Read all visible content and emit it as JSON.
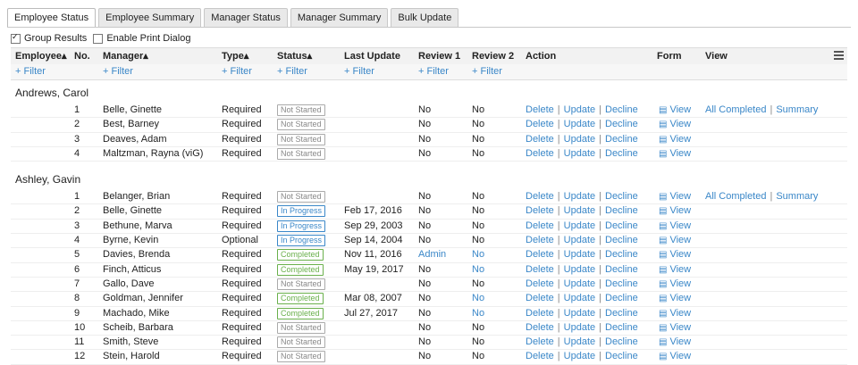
{
  "tabs": [
    "Employee Status",
    "Employee Summary",
    "Manager Status",
    "Manager Summary",
    "Bulk Update"
  ],
  "options": {
    "group_results": "Group Results",
    "print_dialog": "Enable Print Dialog"
  },
  "columns": {
    "employee": "Employee▴",
    "no": "No.",
    "manager": "Manager▴",
    "type": "Type▴",
    "status": "Status▴",
    "last_update": "Last Update",
    "review1": "Review 1",
    "review2": "Review 2",
    "action": "Action",
    "form": "Form",
    "view": "View"
  },
  "filter_label": "+ Filter",
  "actions": {
    "delete": "Delete",
    "update": "Update",
    "decline": "Decline",
    "sep": "|",
    "view": "View",
    "all_completed": "All Completed",
    "summary": "Summary"
  },
  "groups": [
    {
      "name": "Andrews, Carol",
      "rows": [
        {
          "no": "1",
          "manager": "Belle, Ginette",
          "type": "Required",
          "status": "Not Started",
          "last": "",
          "r1": "No",
          "r2": "No"
        },
        {
          "no": "2",
          "manager": "Best, Barney",
          "type": "Required",
          "status": "Not Started",
          "last": "",
          "r1": "No",
          "r2": "No"
        },
        {
          "no": "3",
          "manager": "Deaves, Adam",
          "type": "Required",
          "status": "Not Started",
          "last": "",
          "r1": "No",
          "r2": "No"
        },
        {
          "no": "4",
          "manager": "Maltzman, Rayna (viG)",
          "type": "Required",
          "status": "Not Started",
          "last": "",
          "r1": "No",
          "r2": "No"
        }
      ]
    },
    {
      "name": "Ashley, Gavin",
      "rows": [
        {
          "no": "1",
          "manager": "Belanger, Brian",
          "type": "Required",
          "status": "Not Started",
          "last": "",
          "r1": "No",
          "r2": "No"
        },
        {
          "no": "2",
          "manager": "Belle, Ginette",
          "type": "Required",
          "status": "In Progress",
          "last": "Feb 17, 2016",
          "r1": "No",
          "r2": "No"
        },
        {
          "no": "3",
          "manager": "Bethune, Marva",
          "type": "Required",
          "status": "In Progress",
          "last": "Sep 29, 2003",
          "r1": "No",
          "r2": "No"
        },
        {
          "no": "4",
          "manager": "Byrne, Kevin",
          "type": "Optional",
          "status": "In Progress",
          "last": "Sep 14, 2004",
          "r1": "No",
          "r2": "No"
        },
        {
          "no": "5",
          "manager": "Davies, Brenda",
          "type": "Required",
          "status": "Completed",
          "last": "Nov 11, 2016",
          "r1": "Admin",
          "r2": "No"
        },
        {
          "no": "6",
          "manager": "Finch, Atticus",
          "type": "Required",
          "status": "Completed",
          "last": "May 19, 2017",
          "r1": "No",
          "r2": "No"
        },
        {
          "no": "7",
          "manager": "Gallo, Dave",
          "type": "Required",
          "status": "Not Started",
          "last": "",
          "r1": "No",
          "r2": "No"
        },
        {
          "no": "8",
          "manager": "Goldman, Jennifer",
          "type": "Required",
          "status": "Completed",
          "last": "Mar 08, 2007",
          "r1": "No",
          "r2": "No"
        },
        {
          "no": "9",
          "manager": "Machado, Mike",
          "type": "Required",
          "status": "Completed",
          "last": "Jul 27, 2017",
          "r1": "No",
          "r2": "No"
        },
        {
          "no": "10",
          "manager": "Scheib, Barbara",
          "type": "Required",
          "status": "Not Started",
          "last": "",
          "r1": "No",
          "r2": "No"
        },
        {
          "no": "11",
          "manager": "Smith, Steve",
          "type": "Required",
          "status": "Not Started",
          "last": "",
          "r1": "No",
          "r2": "No"
        },
        {
          "no": "12",
          "manager": "Stein, Harold",
          "type": "Required",
          "status": "Not Started",
          "last": "",
          "r1": "No",
          "r2": "No"
        }
      ]
    }
  ]
}
